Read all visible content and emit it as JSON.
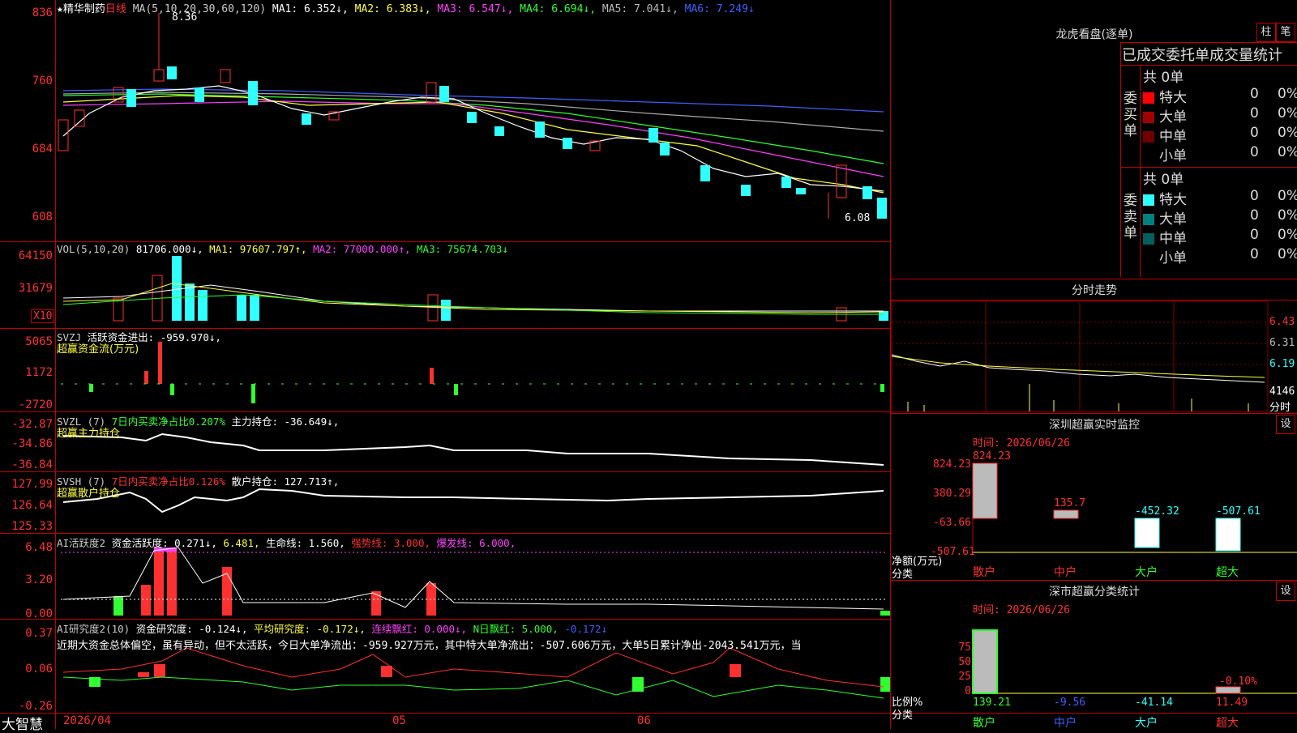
{
  "stock": {
    "name": "精华制药",
    "period": "日线",
    "star": "★"
  },
  "main": {
    "ma_header": [
      {
        "text": "MA(5,10,20,30,60,120)",
        "color": "#cccccc"
      },
      {
        "text": "MA1: 6.352↓,",
        "color": "#ffffff"
      },
      {
        "text": "MA2: 6.383↓,",
        "color": "#ffff40"
      },
      {
        "text": "MA3: 6.547↓,",
        "color": "#ff40ff"
      },
      {
        "text": "MA4: 6.694↓,",
        "color": "#30ff30"
      },
      {
        "text": "MA5: 7.041↓,",
        "color": "#bbbbbb"
      },
      {
        "text": "MA6: 7.249↓",
        "color": "#4060ff"
      }
    ],
    "axis": [
      "836",
      "760",
      "684",
      "608"
    ],
    "high_label": "8.36",
    "low_label": "6.08"
  },
  "vol": {
    "header": [
      {
        "text": "VOL(5,10,20)",
        "color": "#cccccc"
      },
      {
        "text": "81706.000↓,",
        "color": "#ffffff"
      },
      {
        "text": "MA1: 97607.797↑,",
        "color": "#ffff40"
      },
      {
        "text": "MA2: 77000.000↑,",
        "color": "#ff40ff"
      },
      {
        "text": "MA3: 75674.703↓",
        "color": "#30ff30"
      }
    ],
    "axis": [
      "64150",
      "31679"
    ],
    "unit": "X10"
  },
  "svzj": {
    "header": [
      {
        "text": "SVZJ",
        "color": "#cccccc"
      },
      {
        "text": "活跃资金进出: -959.970↓,",
        "color": "#ffffff"
      }
    ],
    "subtitle": "超赢资金流(万元)",
    "axis": [
      "5065",
      "1172",
      "-2720"
    ]
  },
  "svzl": {
    "header": [
      {
        "text": "SVZL (7)",
        "color": "#cccccc"
      },
      {
        "text": "7日内买卖净占比0.207%",
        "color": "#30ff30"
      },
      {
        "text": "主力持仓: -36.649↓,",
        "color": "#ffffff"
      }
    ],
    "subtitle": "超赢主力持仓",
    "axis": [
      "-32.87",
      "-34.86",
      "-36.84"
    ]
  },
  "svsh": {
    "header": [
      {
        "text": "SVSH (7)",
        "color": "#cccccc"
      },
      {
        "text": "7日内买卖净占比0.126%",
        "color": "#ff3030"
      },
      {
        "text": "散户持仓: 127.713↑,",
        "color": "#ffffff"
      }
    ],
    "subtitle": "超赢散户持仓",
    "axis": [
      "127.99",
      "126.64",
      "125.33"
    ]
  },
  "ai1": {
    "header": [
      {
        "text": "AI活跃度2",
        "color": "#cccccc"
      },
      {
        "text": "资金活跃度: 0.271↓,",
        "color": "#ffffff"
      },
      {
        "text": "6.481,",
        "color": "#ffff40"
      },
      {
        "text": "生命线: 1.560,",
        "color": "#ffffff"
      },
      {
        "text": "强势线: 3.000,",
        "color": "#ff3030"
      },
      {
        "text": "爆发线: 6.000,",
        "color": "#ff40ff"
      }
    ],
    "axis": [
      "6.48",
      "3.20",
      "0.00"
    ]
  },
  "ai2": {
    "header": [
      {
        "text": "AI研究度2(10)",
        "color": "#cccccc"
      },
      {
        "text": "资金研究度: -0.124↓,",
        "color": "#ffffff"
      },
      {
        "text": "平均研究度: -0.172↓,",
        "color": "#ffff40"
      },
      {
        "text": "连续飘红: 0.000↓,",
        "color": "#ff40ff"
      },
      {
        "text": "N日飘红: 5.000,",
        "color": "#30ff30"
      },
      {
        "text": "-0.172↓",
        "color": "#4060ff"
      }
    ],
    "comment": "近期大资金总体偏空，虽有异动，但不太活跃，今日大单净流出：-959.927万元，其中特大单净流出：-507.606万元，大单5日累计净出-2043.541万元，当",
    "axis": [
      "0.37",
      "0.06",
      "-0.26"
    ]
  },
  "bottom": {
    "brand": "大智慧",
    "dates": [
      "2026/04",
      "05",
      "06"
    ]
  },
  "right": {
    "lhkp_title": "龙虎看盘(逐单)",
    "btn_bar": "柱",
    "btn_pen": "笔",
    "stats_title": "已成交委托单成交量统计",
    "buy_label": "委买单",
    "sell_label": "委卖单",
    "buy_total": "共 0单",
    "sell_total": "共 0单",
    "buy_rows": [
      {
        "name": "特大",
        "count": "0",
        "pct": "0%",
        "color": "#ff0000"
      },
      {
        "name": "大单",
        "count": "0",
        "pct": "0%",
        "color": "#a00000"
      },
      {
        "name": "中单",
        "count": "0",
        "pct": "0%",
        "color": "#700000"
      },
      {
        "name": "小单",
        "count": "0",
        "pct": "0%",
        "color": "#000000"
      }
    ],
    "sell_rows": [
      {
        "name": "特大",
        "count": "0",
        "pct": "0%",
        "color": "#30ffff"
      },
      {
        "name": "大单",
        "count": "0",
        "pct": "0%",
        "color": "#008080"
      },
      {
        "name": "中单",
        "count": "0",
        "pct": "0%",
        "color": "#006060"
      },
      {
        "name": "小单",
        "count": "0",
        "pct": "0%",
        "color": "#000000"
      }
    ],
    "fenshi_title": "分时走势",
    "fenshi_axis": [
      "6.43",
      "6.31",
      "6.19"
    ],
    "fenshi_vol": "4146",
    "fenshi_label": "分时",
    "sz_monitor": {
      "title": "深圳超赢实时监控",
      "btn": "设",
      "time": "时间: 2026/06/26",
      "axis": [
        "824.23",
        "380.29",
        "-63.66",
        "-507.61"
      ],
      "ylabel": "净额(万元)",
      "xlabel": "分类",
      "values": [
        "824.23",
        "135.7",
        "-452.32",
        "-507.61"
      ],
      "categories": [
        "散户",
        "中户",
        "大户",
        "超大"
      ],
      "cat_colors": [
        "#ff3030",
        "#ff3030",
        "#30ff30",
        "#30ff30"
      ]
    },
    "sz_class": {
      "title": "深市超赢分类统计",
      "btn": "设",
      "time": "时间: 2026/06/26",
      "axis": [
        "75",
        "50",
        "25",
        "0"
      ],
      "ylabel": "比例%",
      "xlabel": "分类",
      "top_label": "-0.10%",
      "values": [
        "139.21",
        "-9.56",
        "-41.14",
        "11.49"
      ],
      "value_colors": [
        "#30ff30",
        "#4060ff",
        "#30ffff",
        "#ff3030"
      ],
      "categories": [
        "散户",
        "中户",
        "大户",
        "超大"
      ]
    }
  }
}
